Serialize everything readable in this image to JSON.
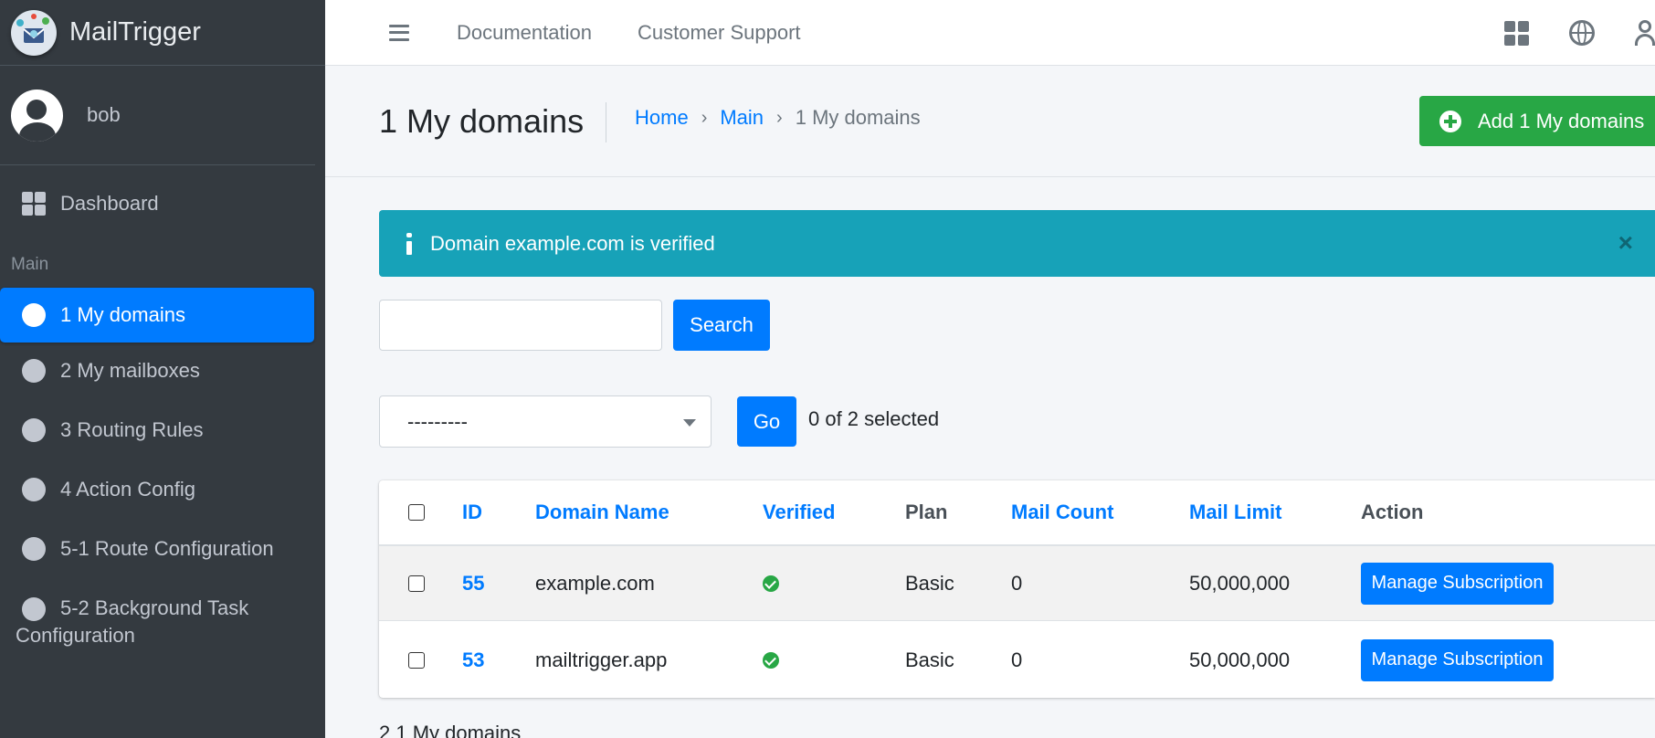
{
  "brand": {
    "name": "MailTrigger"
  },
  "user": {
    "name": "bob"
  },
  "sidebar": {
    "dashboard_label": "Dashboard",
    "section_header": "Main",
    "items": [
      {
        "label": "1 My domains",
        "active": true
      },
      {
        "label": "2 My mailboxes"
      },
      {
        "label": "3 Routing Rules"
      },
      {
        "label": "4 Action Config"
      },
      {
        "label": "5-1 Route Configuration"
      },
      {
        "label_line1": "5-2 Background Task",
        "label_line2": "Configuration"
      }
    ]
  },
  "topbar": {
    "links": [
      "Documentation",
      "Customer Support"
    ],
    "icons": [
      "apps-grid-icon",
      "globe-icon",
      "user-icon"
    ]
  },
  "header": {
    "title": "1 My domains",
    "breadcrumb": [
      "Home",
      "Main",
      "1 My domains"
    ],
    "add_button": "Add 1 My domains"
  },
  "alert": {
    "message": "Domain example.com is verified",
    "close": "×"
  },
  "search": {
    "value": "",
    "button": "Search"
  },
  "actions": {
    "select_value": "---------",
    "go_button": "Go",
    "selection_status": "0 of 2 selected"
  },
  "table": {
    "columns": [
      "ID",
      "Domain Name",
      "Verified",
      "Plan",
      "Mail Count",
      "Mail Limit",
      "Action"
    ],
    "rows": [
      {
        "id": "55",
        "domain": "example.com",
        "verified": true,
        "plan": "Basic",
        "mail_count": "0",
        "mail_limit": "50,000,000",
        "action": "Manage Subscription"
      },
      {
        "id": "53",
        "domain": "mailtrigger.app",
        "verified": true,
        "plan": "Basic",
        "mail_count": "0",
        "mail_limit": "50,000,000",
        "action": "Manage Subscription"
      }
    ]
  },
  "footer": {
    "count_text": "2 1 My domains"
  },
  "colors": {
    "sidebar": "#343a40",
    "active": "#007bff",
    "success": "#28a745",
    "info": "#17a2b8"
  }
}
